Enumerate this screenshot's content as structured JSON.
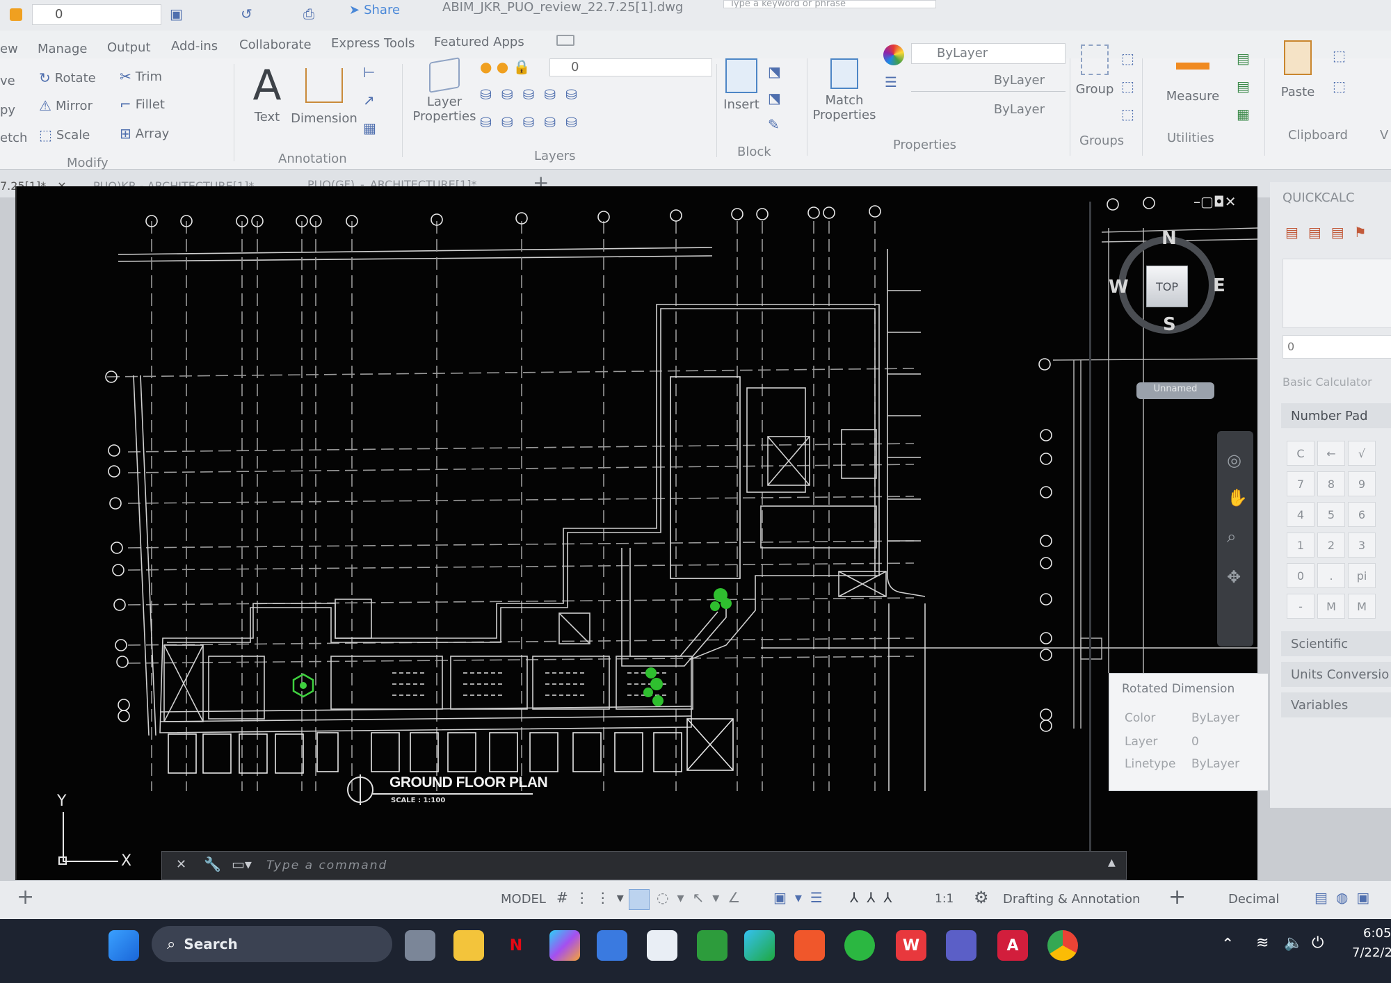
{
  "window": {
    "title": "ABIM_JKR_PUO_review_22.7.25[1].dwg",
    "search_placeholder": "Type a keyword or phrase",
    "share": "Share",
    "layer_value": "0"
  },
  "ribbon_tabs": [
    "ew",
    "Manage",
    "Output",
    "Add-ins",
    "Collaborate",
    "Express Tools",
    "Featured Apps"
  ],
  "modify": {
    "title": "Modify",
    "rotate": "Rotate",
    "trim": "Trim",
    "mirror": "Mirror",
    "fillet": "Fillet",
    "scale": "Scale",
    "array": "Array",
    "cut_left": [
      "ve",
      "py",
      "etch"
    ]
  },
  "annotation": {
    "title": "Annotation",
    "text": "Text",
    "dimension": "Dimension"
  },
  "layers": {
    "title": "Layers",
    "layer_properties_1": "Layer",
    "layer_properties_2": "Properties",
    "current_layer": "0"
  },
  "block": {
    "title": "Block",
    "insert": "Insert"
  },
  "properties": {
    "title": "Properties",
    "match_1": "Match",
    "match_2": "Properties",
    "color": "ByLayer",
    "linetype": "ByLayer",
    "lineweight": "ByLayer"
  },
  "groups": {
    "title": "Groups",
    "group": "Group"
  },
  "utilities": {
    "title": "Utilities",
    "measure": "Measure"
  },
  "clipboard": {
    "title": "Clipboard",
    "paste": "Paste",
    "cut_right": "V"
  },
  "doc_tabs": [
    "7.25[1]*",
    "PUO)KR - ARCHITECTURE[1]*",
    "PUO(GF)_-_ARCHITECTURE[1]*"
  ],
  "drawing": {
    "title": "GROUND FLOOR PLAN",
    "scale": "SCALE : 1:100"
  },
  "viewcube": {
    "n": "N",
    "s": "S",
    "e": "E",
    "w": "W",
    "top": "TOP",
    "ucs": "Unnamed"
  },
  "ucs_axes": {
    "x": "X",
    "y": "Y"
  },
  "quickcalc": {
    "title": "QUICKCALC",
    "value": "0",
    "basic": "Basic Calculator",
    "numpad": "Number Pad",
    "scientific": "Scientific",
    "units": "Units Conversio",
    "variables": "Variables",
    "keys": [
      "C",
      "←",
      "√",
      "7",
      "8",
      "9",
      "4",
      "5",
      "6",
      "1",
      "2",
      "3",
      "0",
      ".",
      "pi",
      "-",
      "M",
      "M"
    ]
  },
  "tooltip": {
    "title": "Rotated Dimension",
    "color_label": "Color",
    "color_value": "ByLayer",
    "layer_label": "Layer",
    "layer_value": "0",
    "linetype_label": "Linetype",
    "linetype_value": "ByLayer"
  },
  "command": {
    "placeholder": "Type a command"
  },
  "status": {
    "model": "MODEL",
    "scale": "1:1",
    "workspace": "Drafting & Annotation",
    "units": "Decimal"
  },
  "taskbar": {
    "search": "Search",
    "time": "6:05",
    "date": "7/22/2"
  }
}
